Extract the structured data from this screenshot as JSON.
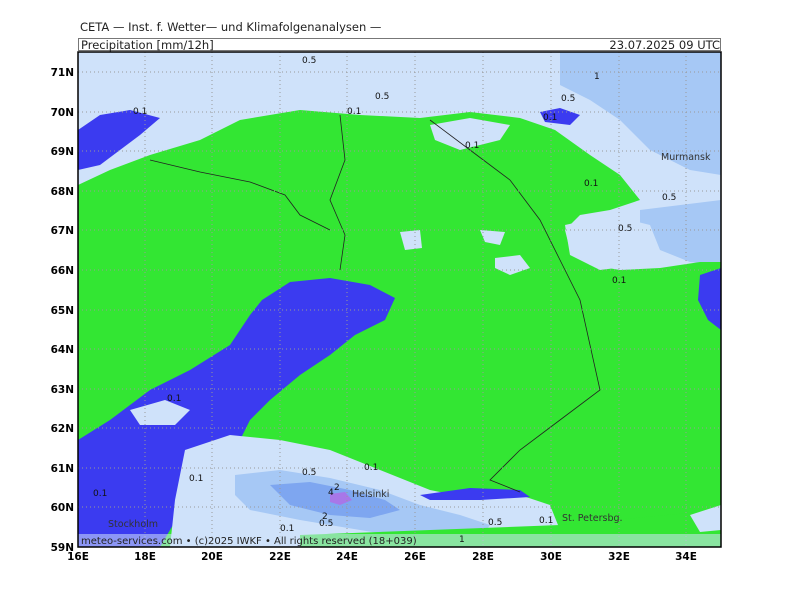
{
  "header": {
    "source": "CETA — Inst. f. Wetter— und Klimafolgenanalysen —",
    "variable": "Precipitation [mm/12h]",
    "valid_time": "23.07.2025 09 UTC"
  },
  "map": {
    "lon_ticks": [
      "16E",
      "18E",
      "20E",
      "22E",
      "24E",
      "26E",
      "28E",
      "30E",
      "32E",
      "34E"
    ],
    "lat_ticks": [
      "71N",
      "70N",
      "69N",
      "68N",
      "67N",
      "66N",
      "65N",
      "64N",
      "63N",
      "62N",
      "61N",
      "60N",
      "59N"
    ],
    "cities": [
      "Murmansk",
      "Helsinki",
      "Stockholm",
      "St. Petersbg."
    ],
    "contour_labels": [
      "0.5",
      "1",
      "0.5",
      "0.1",
      "0.5",
      "0.1",
      "0.1",
      "0.1",
      "0.1",
      "0.5",
      "0.5",
      "0.1",
      "0.1",
      "0.5",
      "0.1",
      "0.1",
      "2",
      "4",
      "2",
      "0.5",
      "0.1",
      "0.5",
      "0.1",
      "1",
      "0.1"
    ],
    "colors": {
      "land_low": "#33e633",
      "light_blue": "#cfe2fa",
      "mid_blue": "#a6c8f5",
      "blue": "#7ea6f0",
      "water": "#3b3bf0",
      "violet": "#a877e8"
    }
  },
  "footer": {
    "credit": "meteo-services.com • (c)2025 IWKF • All rights reserved (18+039)"
  }
}
